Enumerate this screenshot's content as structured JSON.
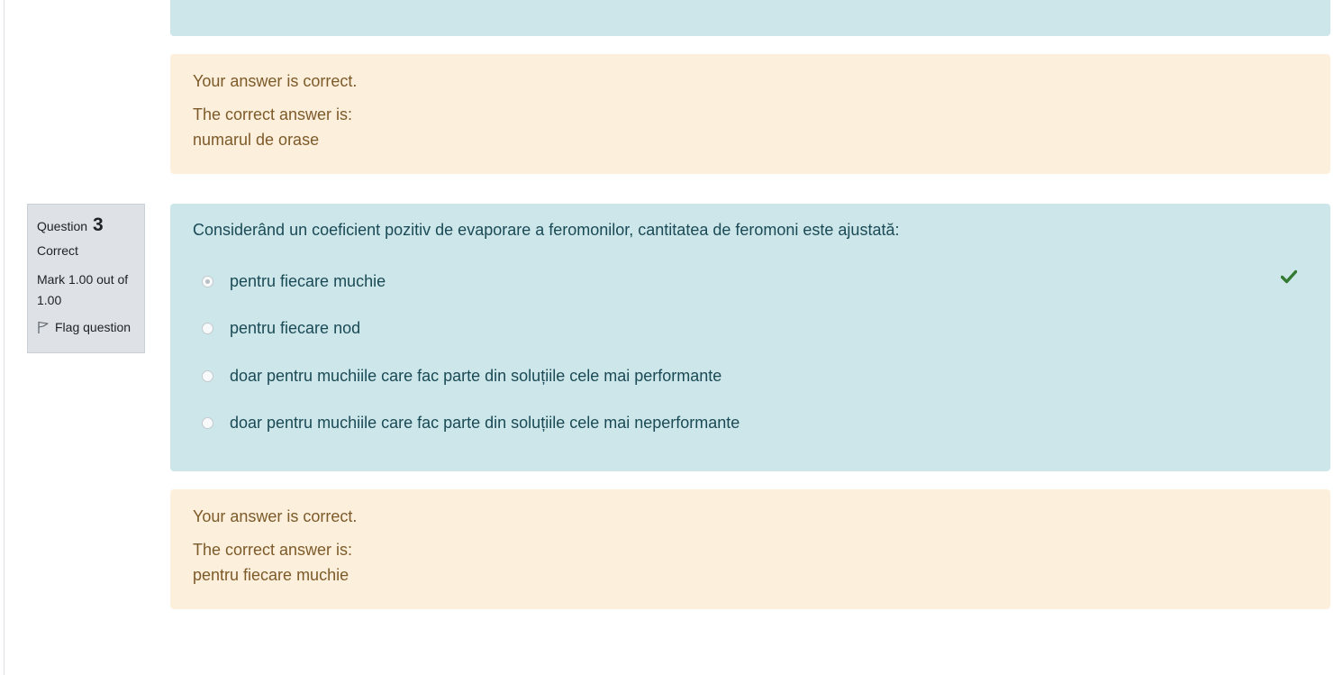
{
  "previous_question": {
    "feedback": "Your answer is correct.",
    "right_answer_label": "The correct answer is:",
    "right_answer": "numarul de orase"
  },
  "question": {
    "info": {
      "label": "Question",
      "number": "3",
      "state": "Correct",
      "grade": "Mark 1.00 out of 1.00",
      "flag_label": "Flag question"
    },
    "text": "Considerând un coeficient pozitiv de evaporare a feromonilor, cantitatea de feromoni este ajustată:",
    "options": [
      {
        "label": "pentru fiecare muchie",
        "selected": true,
        "correct": true
      },
      {
        "label": "pentru fiecare nod",
        "selected": false
      },
      {
        "label": "doar pentru muchiile care fac parte din soluțiile cele mai performante",
        "selected": false
      },
      {
        "label": "doar pentru muchiile care fac parte din soluțiile cele mai neperformante",
        "selected": false
      }
    ],
    "correct_icon": "check-icon",
    "correct_icon_color": "#357a32",
    "outcome": {
      "feedback": "Your answer is correct.",
      "right_answer_label": "The correct answer is:",
      "right_answer": "pentru fiecare muchie"
    }
  },
  "colors": {
    "formulation_bg": "#cce6ea",
    "outcome_bg": "#fcefdc",
    "info_bg": "#dee2e6"
  }
}
